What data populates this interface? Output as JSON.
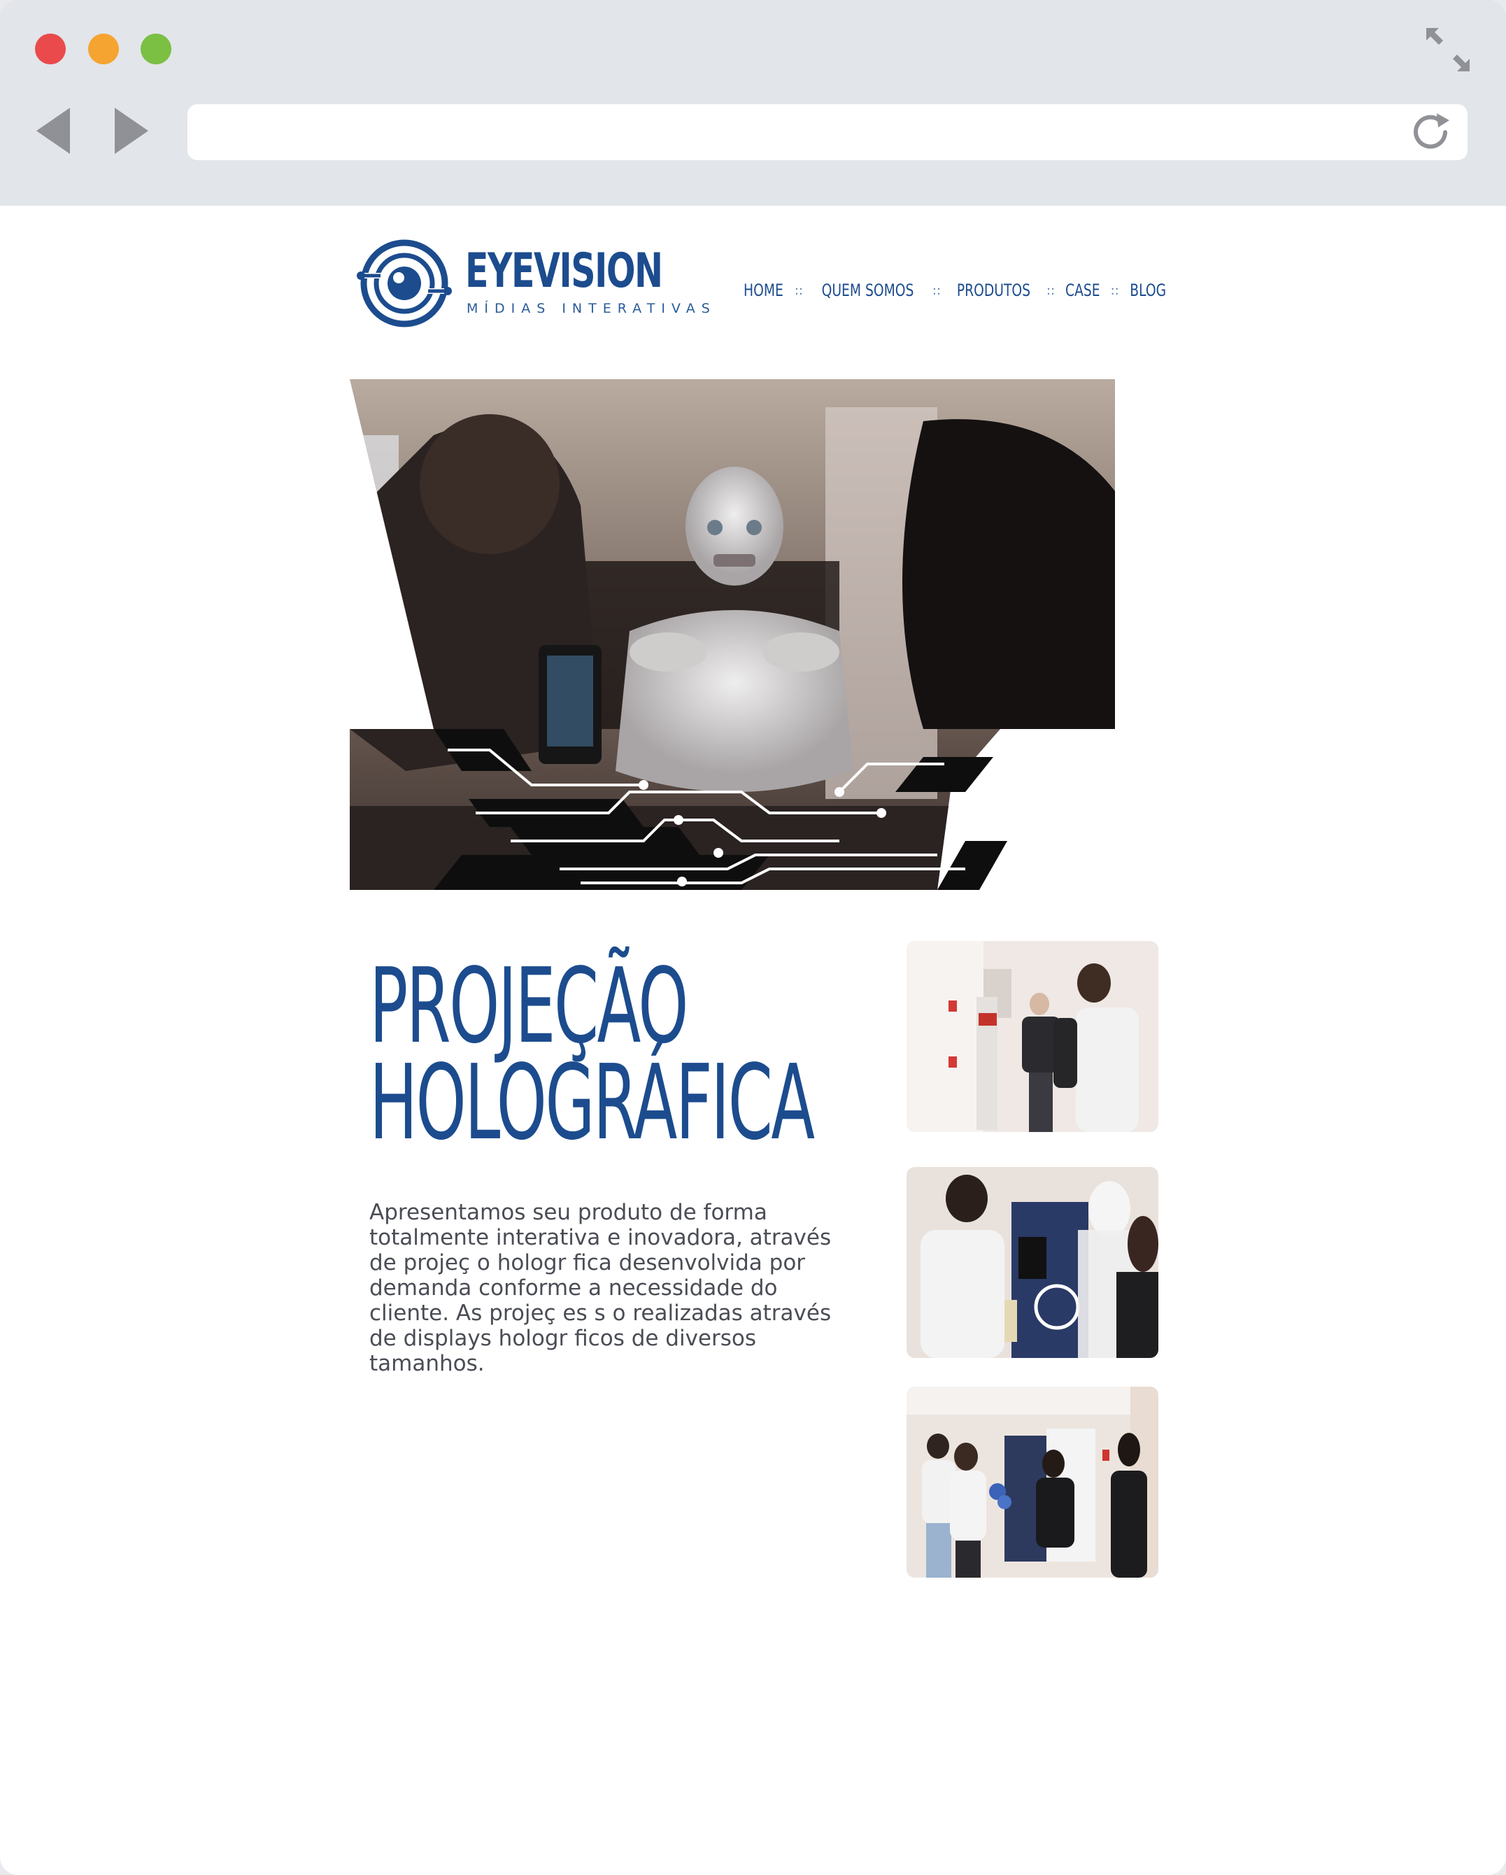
{
  "browser": {
    "url": ""
  },
  "brand": {
    "name": "EYEVISION",
    "tagline": "MÍDIAS INTERATIVAS",
    "color": "#1c4c8e"
  },
  "nav": {
    "items": [
      {
        "label": "HOME"
      },
      {
        "label": "QUEM SOMOS"
      },
      {
        "label": "PRODUTOS"
      },
      {
        "label": "CASE"
      },
      {
        "label": "BLOG"
      }
    ],
    "separator": "::"
  },
  "hero": {
    "image": "robot-hologram-photo"
  },
  "content": {
    "title_line1": "PROJEÇÃO",
    "title_line2": "HOLOGRÁFICA",
    "description": "Apresentamos seu produto de forma totalmente interativa e inovadora, através de projeç  o hologr  fica desenvolvida por demanda conforme a necessidade do cliente. As projeç  es s  o realizadas através de displays hologr  ficos de diversos tamanhos."
  },
  "gallery": {
    "thumbs": [
      {
        "name": "event-photo-1"
      },
      {
        "name": "event-photo-2"
      },
      {
        "name": "event-photo-3"
      }
    ]
  }
}
